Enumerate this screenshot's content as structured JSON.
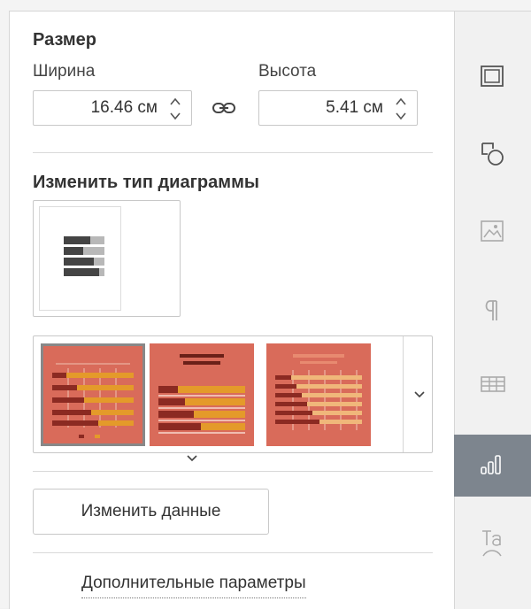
{
  "size": {
    "heading": "Размер",
    "width_label": "Ширина",
    "height_label": "Высота",
    "width_value": "16.46 см",
    "height_value": "5.41 см"
  },
  "chart_type": {
    "heading": "Изменить тип диаграммы"
  },
  "chart_styles": {
    "thumbnails": [
      {
        "name": "style-1",
        "selected": true
      },
      {
        "name": "style-2",
        "selected": false
      },
      {
        "name": "style-3",
        "selected": false
      }
    ]
  },
  "actions": {
    "change_data_label": "Изменить данные",
    "advanced_settings_label": "Дополнительные параметры"
  },
  "right_toolbar": {
    "items": [
      {
        "icon": "slide-settings-icon",
        "active": false
      },
      {
        "icon": "shape-settings-icon",
        "active": false
      },
      {
        "icon": "image-settings-icon",
        "active": false
      },
      {
        "icon": "paragraph-settings-icon",
        "active": false
      },
      {
        "icon": "table-settings-icon",
        "active": false
      },
      {
        "icon": "chart-settings-icon",
        "active": true
      },
      {
        "icon": "text-art-settings-icon",
        "active": false
      }
    ]
  },
  "colors": {
    "accent_active_tab": "#7d858e",
    "thumb_background": "#d96b5a",
    "bar_dark": "#8b2a22",
    "bar_orange": "#e49a2a"
  }
}
